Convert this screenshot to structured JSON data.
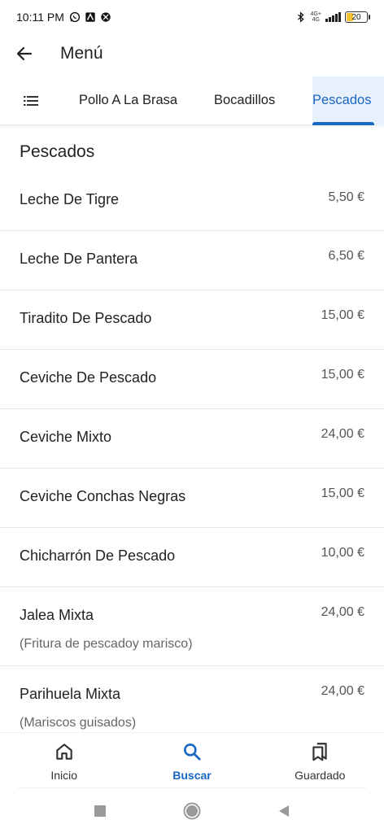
{
  "status_bar": {
    "time": "10:11 PM",
    "network_top": "4G+",
    "network_bottom": "4G",
    "battery_level": "20"
  },
  "app_bar": {
    "title": "Menú"
  },
  "tabs": [
    {
      "label": "Pollo A La Brasa"
    },
    {
      "label": "Bocadillos"
    },
    {
      "label": "Pescados",
      "selected": true
    }
  ],
  "section": {
    "title": "Pescados"
  },
  "items": [
    {
      "name": "Leche De Tigre",
      "price": "5,50 €"
    },
    {
      "name": "Leche De Pantera",
      "price": "6,50 €"
    },
    {
      "name": "Tiradito De Pescado",
      "price": "15,00 €"
    },
    {
      "name": "Ceviche De Pescado",
      "price": "15,00 €"
    },
    {
      "name": "Ceviche Mixto",
      "price": "24,00 €"
    },
    {
      "name": "Ceviche Conchas Negras",
      "price": "15,00 €"
    },
    {
      "name": "Chicharrón De Pescado",
      "price": "10,00 €"
    },
    {
      "name": "Jalea Mixta",
      "price": "24,00 €",
      "description": "(Fritura de pescadoy marisco)"
    },
    {
      "name": "Parihuela Mixta",
      "price": "24,00 €",
      "description": "(Mariscos guisados)"
    }
  ],
  "bottom_nav": [
    {
      "label": "Inicio",
      "icon": "home-icon"
    },
    {
      "label": "Buscar",
      "icon": "search-icon",
      "active": true
    },
    {
      "label": "Guardado",
      "icon": "bookmarks-icon"
    }
  ],
  "colors": {
    "accent": "#1a66c4",
    "selected_tab_bg": "#e8f0fb"
  }
}
